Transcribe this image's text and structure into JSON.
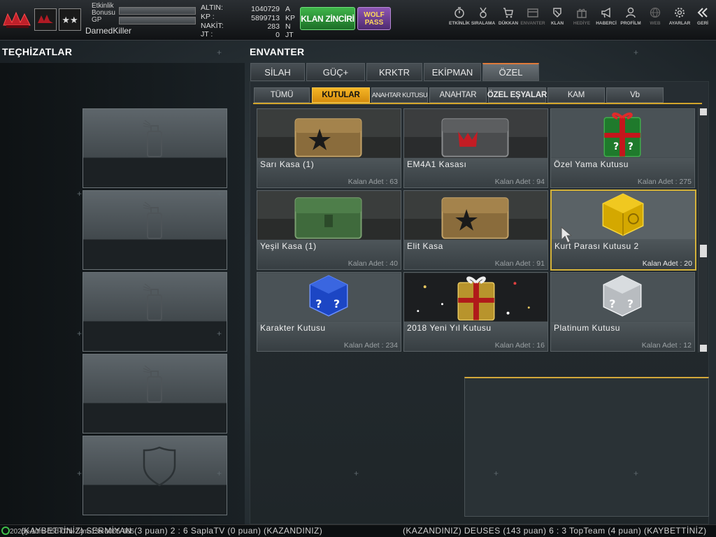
{
  "header": {
    "event_bonus_label": "Etkinlik\nBonusu",
    "gp_label": "GP",
    "username": "DarnedKiller",
    "currencies": [
      {
        "label": "ALTIN:",
        "value": "1040729",
        "unit": "A"
      },
      {
        "label": "KP  :",
        "value": "5899713",
        "unit": "KP"
      },
      {
        "label": "NAKİT:",
        "value": "283",
        "unit": "N"
      },
      {
        "label": "JT   :",
        "value": "0",
        "unit": "JT"
      }
    ],
    "klan_button": "KLAN ZİNCİRİ",
    "wolf_pass_line1": "WOLF",
    "wolf_pass_line2": "PASS",
    "nav": [
      {
        "label": "ETKİNLİK",
        "icon": "stopwatch-icon"
      },
      {
        "label": "SIRALAMA",
        "icon": "medal-icon"
      },
      {
        "label": "DÜKKAN",
        "icon": "cart-icon"
      },
      {
        "label": "ENVANTER",
        "icon": "inventory-icon"
      },
      {
        "label": "KLAN",
        "icon": "clan-icon"
      },
      {
        "label": "HEDİYE",
        "icon": "gift-icon"
      },
      {
        "label": "HABERCİ",
        "icon": "megaphone-icon"
      },
      {
        "label": "PROFİLM",
        "icon": "profile-icon"
      },
      {
        "label": "WEB",
        "icon": "globe-icon"
      },
      {
        "label": "AYARLAR",
        "icon": "gear-icon"
      },
      {
        "label": "GERİ",
        "icon": "back-icon"
      }
    ]
  },
  "equipment": {
    "title": "TEÇHİZATLAR",
    "slots": [
      {
        "icon": "spray-can-icon"
      },
      {
        "icon": "spray-can-icon"
      },
      {
        "icon": "spray-can-icon"
      },
      {
        "icon": "spray-can-icon"
      },
      {
        "icon": "shield-icon"
      }
    ]
  },
  "inventory": {
    "title": "ENVANTER",
    "tabs": [
      "SİLAH",
      "GÜÇ+",
      "KRKTR",
      "EKİPMAN",
      "ÖZEL"
    ],
    "active_tab": "ÖZEL",
    "subtabs": [
      "TÜMÜ",
      "KUTULAR",
      "ANAHTAR KUTUSU",
      "ANAHTAR",
      "ÖZEL EŞYALAR",
      "KAM",
      "Vb"
    ],
    "active_subtab": "KUTULAR",
    "items": [
      {
        "name": "Sarı Kasa (1)",
        "qty": "Kalan Adet : 63"
      },
      {
        "name": "EM4A1 Kasası",
        "qty": "Kalan Adet : 94"
      },
      {
        "name": "Özel Yama Kutusu",
        "qty": "Kalan Adet : 275"
      },
      {
        "name": "Yeşil Kasa (1)",
        "qty": "Kalan Adet : 40"
      },
      {
        "name": "Elit Kasa",
        "qty": "Kalan Adet : 91"
      },
      {
        "name": "Kurt Parası Kutusu 2",
        "qty": "Kalan Adet : 20"
      },
      {
        "name": "Karakter Kutusu",
        "qty": "Kalan Adet : 234"
      },
      {
        "name": "2018 Yeni Yıl Kutusu",
        "qty": "Kalan Adet : 16"
      },
      {
        "name": "Platinum Kutusu",
        "qty": "Kalan Adet : 12"
      }
    ],
    "selected_index": 5
  },
  "ticker": {
    "timestamp": "2025y-10m-05d-07h-24m-13s-0065-665",
    "text_left": "(KAYBETTİNİZ) SERMİYAN (3 puan) 2 : 6 SaplaTV (0 puan) (KAZANDINIZ)",
    "text_right": "(KAZANDINIZ) DEUSES (143 puan) 6 : 3 TopTeam (4 puan) (KAYBETTİNİZ)"
  }
}
